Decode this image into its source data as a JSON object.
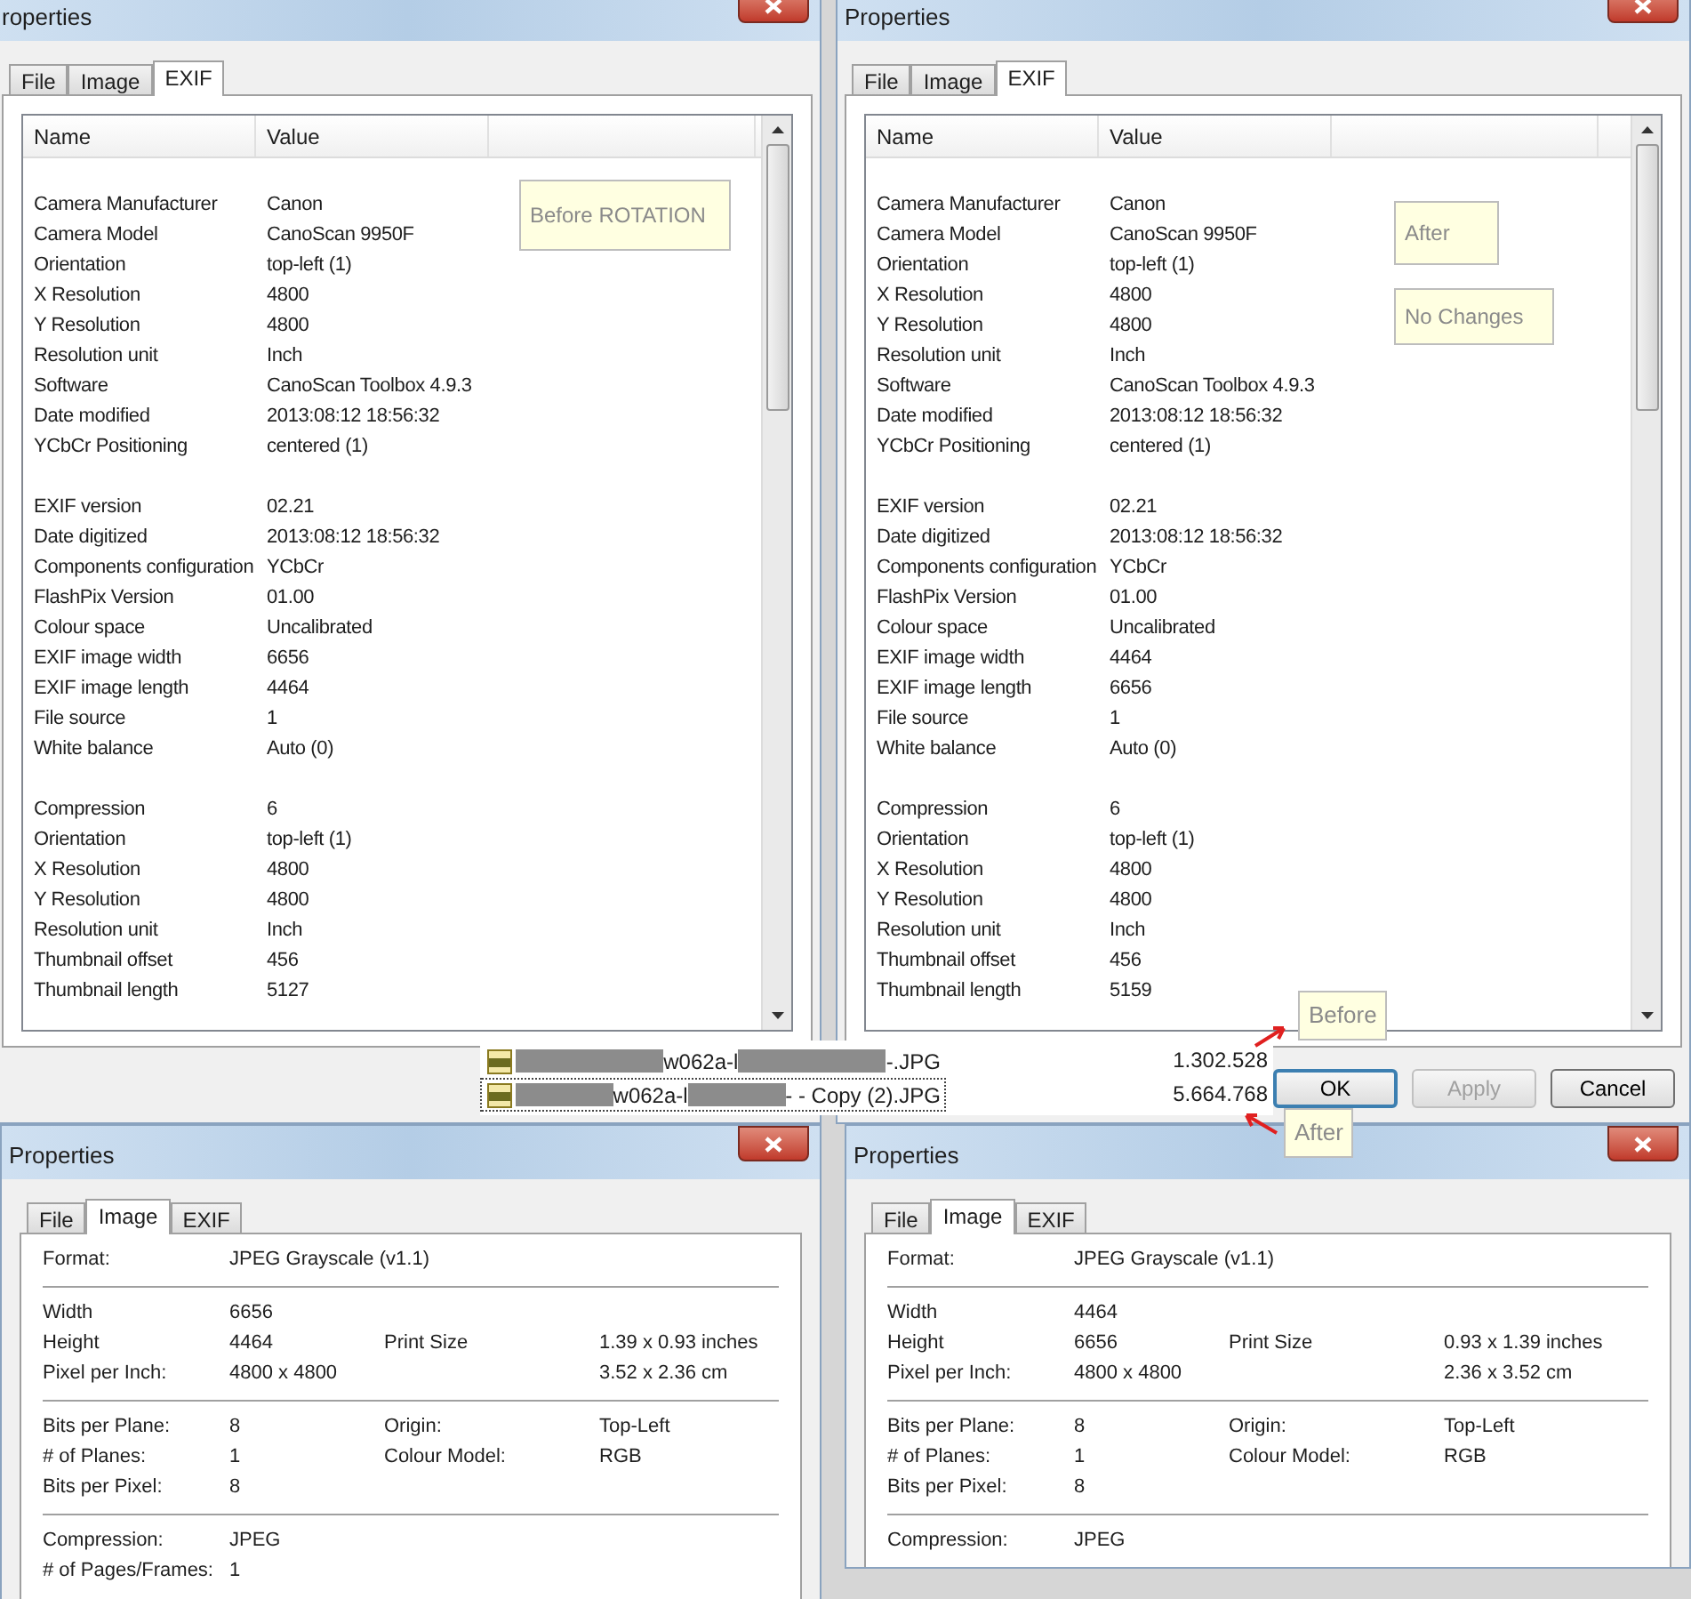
{
  "exif_windows": [
    {
      "title": "roperties",
      "tabs": [
        {
          "label": "File",
          "selected": false
        },
        {
          "label": "Image",
          "selected": false
        },
        {
          "label": "EXIF",
          "selected": true
        }
      ],
      "columns": [
        "Name",
        "Value"
      ],
      "notes": [
        "Before ROTATION"
      ],
      "groups": [
        [
          {
            "name": "Camera Manufacturer",
            "value": "Canon"
          },
          {
            "name": "Camera Model",
            "value": "CanoScan 9950F"
          },
          {
            "name": "Orientation",
            "value": "top-left (1)"
          },
          {
            "name": "X Resolution",
            "value": "4800"
          },
          {
            "name": "Y Resolution",
            "value": "4800"
          },
          {
            "name": "Resolution unit",
            "value": "Inch"
          },
          {
            "name": "Software",
            "value": "CanoScan Toolbox 4.9.3"
          },
          {
            "name": "Date modified",
            "value": "2013:08:12 18:56:32"
          },
          {
            "name": "YCbCr Positioning",
            "value": "centered (1)"
          }
        ],
        [
          {
            "name": "EXIF version",
            "value": "02.21"
          },
          {
            "name": "Date digitized",
            "value": "2013:08:12 18:56:32"
          },
          {
            "name": "Components configuration",
            "value": "YCbCr"
          },
          {
            "name": "FlashPix Version",
            "value": "01.00"
          },
          {
            "name": "Colour space",
            "value": "Uncalibrated"
          },
          {
            "name": "EXIF image width",
            "value": "6656"
          },
          {
            "name": "EXIF image length",
            "value": "4464"
          },
          {
            "name": "File source",
            "value": "1"
          },
          {
            "name": "White balance",
            "value": "Auto (0)"
          }
        ],
        [
          {
            "name": "Compression",
            "value": "6"
          },
          {
            "name": "Orientation",
            "value": "top-left (1)"
          },
          {
            "name": "X Resolution",
            "value": "4800"
          },
          {
            "name": "Y Resolution",
            "value": "4800"
          },
          {
            "name": "Resolution unit",
            "value": "Inch"
          },
          {
            "name": "Thumbnail offset",
            "value": "456"
          },
          {
            "name": "Thumbnail length",
            "value": "5127"
          }
        ]
      ]
    },
    {
      "title": "Properties",
      "tabs": [
        {
          "label": "File",
          "selected": false
        },
        {
          "label": "Image",
          "selected": false
        },
        {
          "label": "EXIF",
          "selected": true
        }
      ],
      "columns": [
        "Name",
        "Value"
      ],
      "notes": [
        "After",
        "No Changes"
      ],
      "groups": [
        [
          {
            "name": "Camera Manufacturer",
            "value": "Canon"
          },
          {
            "name": "Camera Model",
            "value": "CanoScan 9950F"
          },
          {
            "name": "Orientation",
            "value": "top-left (1)"
          },
          {
            "name": "X Resolution",
            "value": "4800"
          },
          {
            "name": "Y Resolution",
            "value": "4800"
          },
          {
            "name": "Resolution unit",
            "value": "Inch"
          },
          {
            "name": "Software",
            "value": "CanoScan Toolbox 4.9.3"
          },
          {
            "name": "Date modified",
            "value": "2013:08:12 18:56:32"
          },
          {
            "name": "YCbCr Positioning",
            "value": "centered (1)"
          }
        ],
        [
          {
            "name": "EXIF version",
            "value": "02.21"
          },
          {
            "name": "Date digitized",
            "value": "2013:08:12 18:56:32"
          },
          {
            "name": "Components configuration",
            "value": "YCbCr"
          },
          {
            "name": "FlashPix Version",
            "value": "01.00"
          },
          {
            "name": "Colour space",
            "value": "Uncalibrated"
          },
          {
            "name": "EXIF image width",
            "value": "4464"
          },
          {
            "name": "EXIF image length",
            "value": "6656"
          },
          {
            "name": "File source",
            "value": "1"
          },
          {
            "name": "White balance",
            "value": "Auto (0)"
          }
        ],
        [
          {
            "name": "Compression",
            "value": "6"
          },
          {
            "name": "Orientation",
            "value": "top-left (1)"
          },
          {
            "name": "X Resolution",
            "value": "4800"
          },
          {
            "name": "Y Resolution",
            "value": "4800"
          },
          {
            "name": "Resolution unit",
            "value": "Inch"
          },
          {
            "name": "Thumbnail offset",
            "value": "456"
          },
          {
            "name": "Thumbnail length",
            "value": "5159"
          }
        ]
      ],
      "buttons": [
        {
          "label": "OK",
          "disabled": false,
          "selected": true
        },
        {
          "label": "Apply",
          "disabled": true,
          "selected": false
        },
        {
          "label": "Cancel",
          "disabled": false,
          "selected": false
        }
      ]
    }
  ],
  "file_list": [
    {
      "parts": [
        {
          "kind": "redacted"
        },
        {
          "kind": "text",
          "text": "w062a-l"
        },
        {
          "kind": "redacted"
        },
        {
          "kind": "text",
          "text": "-.JPG"
        }
      ],
      "size": "1.302.528",
      "selected": false
    },
    {
      "parts": [
        {
          "kind": "redacted"
        },
        {
          "kind": "text",
          "text": "w062a-l"
        },
        {
          "kind": "redacted"
        },
        {
          "kind": "text",
          "text": "- - Copy (2).JPG"
        }
      ],
      "size": "5.664.768",
      "selected": true
    }
  ],
  "callouts": [
    {
      "text": "Before"
    },
    {
      "text": "After"
    }
  ],
  "image_windows": [
    {
      "title": "Properties",
      "tabs": [
        {
          "label": "File",
          "selected": false
        },
        {
          "label": "Image",
          "selected": true
        },
        {
          "label": "EXIF",
          "selected": false
        }
      ],
      "sections": [
        [
          {
            "label": "Format:",
            "value": "JPEG Grayscale (v1.1)"
          }
        ],
        [
          {
            "label": "Width",
            "value": "6656"
          },
          {
            "label": "Height",
            "value": "4464",
            "label_2": "Print Size",
            "value_2": "1.39 x 0.93 inches"
          },
          {
            "label": "Pixel per Inch:",
            "value": "4800 x 4800",
            "value_2": "3.52 x 2.36 cm"
          }
        ],
        [
          {
            "label": "Bits per Plane:",
            "value": "8",
            "label_2": "Origin:",
            "value_2": "Top-Left"
          },
          {
            "label": "# of Planes:",
            "value": "1",
            "label_2": "Colour Model:",
            "value_2": "RGB"
          },
          {
            "label": "Bits per Pixel:",
            "value": "8"
          }
        ],
        [
          {
            "label": "Compression:",
            "value": "JPEG"
          },
          {
            "label": "# of Pages/Frames:",
            "value": "1"
          }
        ]
      ]
    },
    {
      "title": "Properties",
      "tabs": [
        {
          "label": "File",
          "selected": false
        },
        {
          "label": "Image",
          "selected": true
        },
        {
          "label": "EXIF",
          "selected": false
        }
      ],
      "sections": [
        [
          {
            "label": "Format:",
            "value": "JPEG Grayscale (v1.1)"
          }
        ],
        [
          {
            "label": "Width",
            "value": "4464"
          },
          {
            "label": "Height",
            "value": "6656",
            "label_2": "Print Size",
            "value_2": "0.93 x 1.39 inches"
          },
          {
            "label": "Pixel per Inch:",
            "value": "4800 x 4800",
            "value_2": "2.36 x 3.52 cm"
          }
        ],
        [
          {
            "label": "Bits per Plane:",
            "value": "8",
            "label_2": "Origin:",
            "value_2": "Top-Left"
          },
          {
            "label": "# of Planes:",
            "value": "1",
            "label_2": "Colour Model:",
            "value_2": "RGB"
          },
          {
            "label": "Bits per Pixel:",
            "value": "8"
          }
        ],
        [
          {
            "label": "Compression:",
            "value": "JPEG"
          }
        ]
      ]
    }
  ]
}
